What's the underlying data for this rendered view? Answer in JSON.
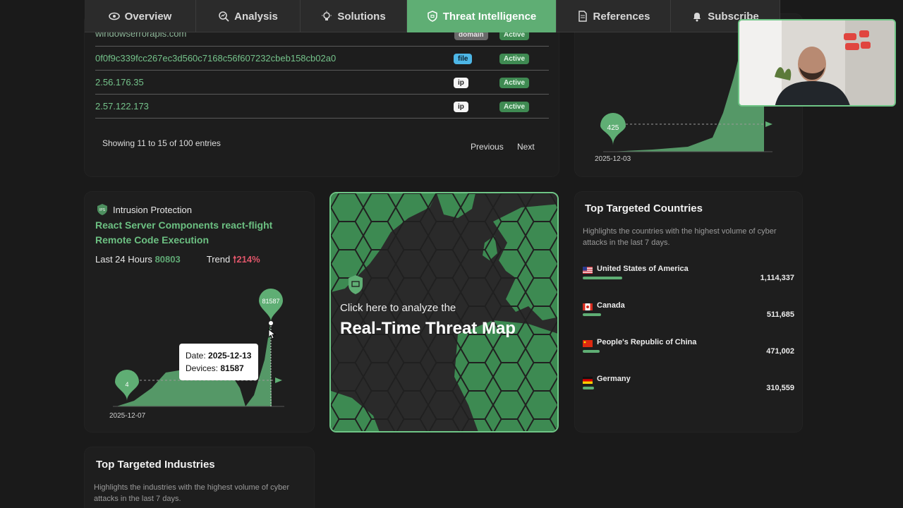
{
  "nav": {
    "tabs": [
      {
        "label": "Overview",
        "icon": "eye-icon"
      },
      {
        "label": "Analysis",
        "icon": "magnifier-chart-icon"
      },
      {
        "label": "Solutions",
        "icon": "lightbulb-icon"
      },
      {
        "label": "Threat Intelligence",
        "icon": "shield-icon",
        "active": true
      },
      {
        "label": "References",
        "icon": "document-icon"
      },
      {
        "label": "Subscribe",
        "icon": "bell-icon"
      }
    ]
  },
  "entries": {
    "rows": [
      {
        "ioc": "windowserrorapis.com",
        "type": "domain",
        "status": "Active"
      },
      {
        "ioc": "0f0f9c339fcc267ec3d560c7168c56f607232cbeb158cb02a0",
        "type": "file",
        "status": "Active"
      },
      {
        "ioc": "2.56.176.35",
        "type": "ip",
        "status": "Active"
      },
      {
        "ioc": "2.57.122.173",
        "type": "ip",
        "status": "Active"
      }
    ],
    "footer": "Showing 11 to 15 of 100 entries",
    "previous": "Previous",
    "next": "Next"
  },
  "trend_chart": {
    "start_value": "425",
    "start_date": "2025-12-03"
  },
  "intrusion": {
    "category": "Intrusion Protection",
    "title": "React Server Components react-flight Remote Code Execution",
    "last24_label": "Last 24 Hours",
    "last24_value": "80803",
    "trend_label": "Trend",
    "trend_value": "214%",
    "chart": {
      "start_value": "4",
      "peak_value": "81587",
      "start_date": "2025-12-07",
      "tooltip_date_label": "Date:",
      "tooltip_date": "2025-12-13",
      "tooltip_devices_label": "Devices:",
      "tooltip_devices": "81587"
    }
  },
  "threat_map": {
    "line1": "Click here to analyze the",
    "line2": "Real-Time Threat Map"
  },
  "countries": {
    "title": "Top Targeted Countries",
    "description": "Highlights the countries with the highest volume of cyber attacks in the last 7 days.",
    "items": [
      {
        "name": "United States of America",
        "value": "1,114,337",
        "share": 1.0
      },
      {
        "name": "Canada",
        "value": "511,685",
        "share": 0.46
      },
      {
        "name": "People's Republic of China",
        "value": "471,002",
        "share": 0.42
      },
      {
        "name": "Germany",
        "value": "310,559",
        "share": 0.28
      }
    ]
  },
  "industries": {
    "title": "Top Targeted Industries",
    "description": "Highlights the industries with the highest volume of cyber attacks in the last 7 days."
  },
  "colors": {
    "accent": "#5fae74",
    "background": "#1a1a1a",
    "trend_up": "#e0566a"
  }
}
